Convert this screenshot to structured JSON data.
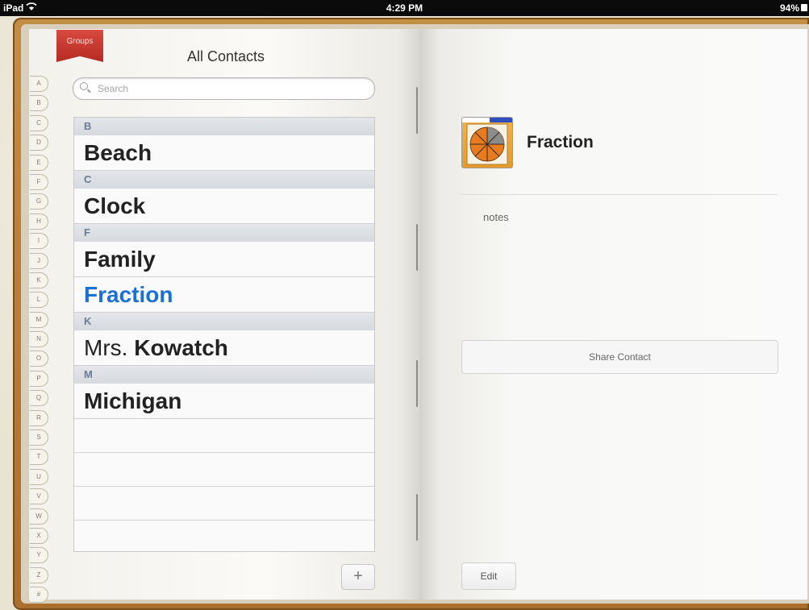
{
  "status_bar": {
    "device": "iPad",
    "time": "4:29 PM",
    "battery": "94%"
  },
  "list_page": {
    "groups_label": "Groups",
    "title": "All Contacts",
    "search_placeholder": "Search",
    "alphabet": [
      "A",
      "B",
      "C",
      "D",
      "E",
      "F",
      "G",
      "H",
      "I",
      "J",
      "K",
      "L",
      "M",
      "N",
      "O",
      "P",
      "Q",
      "R",
      "S",
      "T",
      "U",
      "V",
      "W",
      "X",
      "Y",
      "Z",
      "#"
    ],
    "sections": [
      {
        "letter": "B",
        "contacts": [
          {
            "prefix": "",
            "name": "Beach"
          }
        ]
      },
      {
        "letter": "C",
        "contacts": [
          {
            "prefix": "",
            "name": "Clock"
          }
        ]
      },
      {
        "letter": "F",
        "contacts": [
          {
            "prefix": "",
            "name": "Family"
          },
          {
            "prefix": "",
            "name": "Fraction"
          }
        ]
      },
      {
        "letter": "K",
        "contacts": [
          {
            "prefix": "Mrs.",
            "name": "Kowatch"
          }
        ]
      },
      {
        "letter": "M",
        "contacts": [
          {
            "prefix": "",
            "name": "Michigan"
          }
        ]
      }
    ],
    "selected_contact": "Fraction",
    "add_label": "+"
  },
  "detail_page": {
    "name": "Fraction",
    "notes_label": "notes",
    "share_label": "Share Contact",
    "edit_label": "Edit"
  },
  "colors": {
    "selected": "#1a71d4",
    "groups_ribbon": "#c8352c",
    "section_header_text": "#6b7b98"
  }
}
